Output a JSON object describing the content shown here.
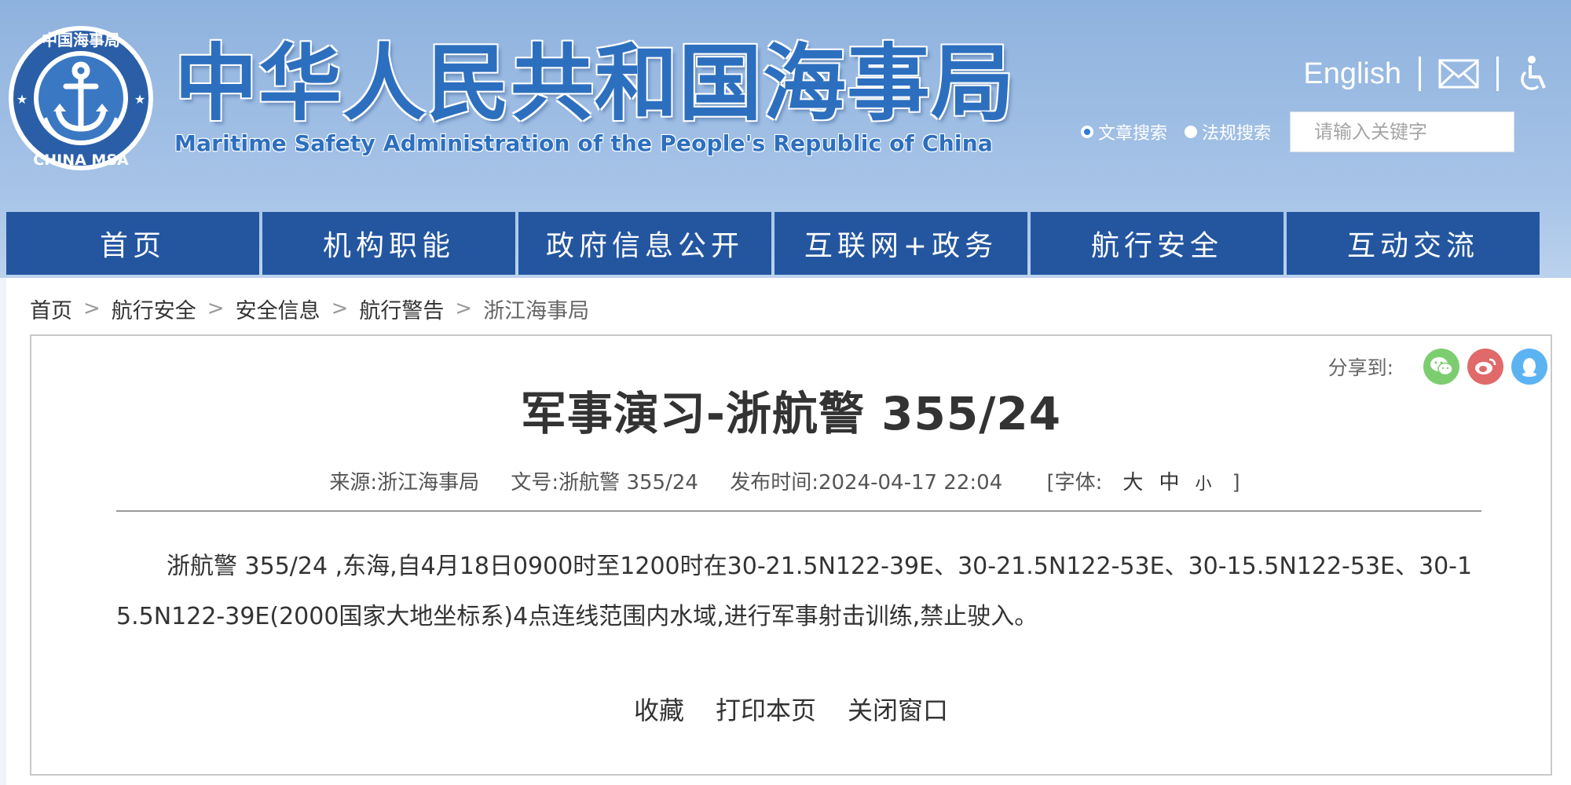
{
  "header": {
    "seal_text_top": "中国海事局",
    "seal_text_bottom": "CHINA MSA",
    "title_cn": "中华人民共和国海事局",
    "title_en": "Maritime Safety Administration of the People's Republic of China",
    "english_link": "English",
    "search": {
      "option_article": "文章搜索",
      "option_law": "法规搜索",
      "selected": "文章搜索",
      "placeholder": "请输入关键字"
    }
  },
  "nav": {
    "items": [
      {
        "label": "首页"
      },
      {
        "label": "机构职能"
      },
      {
        "label": "政府信息公开"
      },
      {
        "label": "互联网+政务"
      },
      {
        "label": "航行安全"
      },
      {
        "label": "互动交流"
      }
    ]
  },
  "breadcrumb": {
    "items": [
      "首页",
      "航行安全",
      "安全信息",
      "航行警告",
      "浙江海事局"
    ]
  },
  "article": {
    "share_label": "分享到:",
    "title": "军事演习-浙航警 355/24",
    "source": "来源:浙江海事局",
    "doc_no": "文号:浙航警 355/24",
    "publish_time": "发布时间:2024-04-17 22:04",
    "font_size_label": "[字体:",
    "font_large": "大",
    "font_medium": "中",
    "font_small": "小",
    "font_close": "]",
    "body": "浙航警  355/24    ,东海,自4月18日0900时至1200时在30-21.5N122-39E、30-21.5N122-53E、30-15.5N122-53E、30-15.5N122-39E(2000国家大地坐标系)4点连线范围内水域,进行军事射击训练,禁止驶入。",
    "actions": {
      "favorite": "收藏",
      "print": "打印本页",
      "close": "关闭窗口"
    }
  },
  "colors": {
    "nav_bg": "#2456a0",
    "title_blue": "#2d6fbf",
    "wechat": "#7ccd70",
    "weibo": "#e06a6a",
    "qq": "#5cb3f2"
  }
}
